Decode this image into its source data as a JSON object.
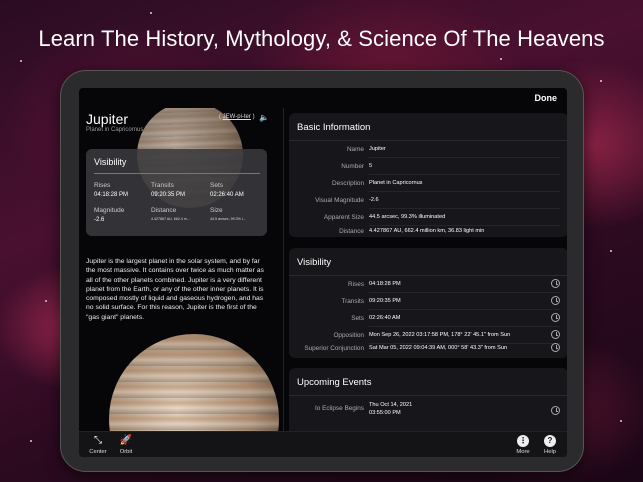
{
  "headline": "Learn The History, Mythology, & Science Of The Heavens",
  "topbar": {
    "done_label": "Done"
  },
  "object": {
    "name": "Jupiter",
    "subtitle": "Planet in Capricornus",
    "pronunciation_open": "(",
    "pronunciation": "JEW-pi-ter",
    "pronunciation_close": ")",
    "speaker_icon": "speaker-icon"
  },
  "visibility_card": {
    "title": "Visibility",
    "rises_label": "Rises",
    "rises_value": "04:18:28 PM",
    "transits_label": "Transits",
    "transits_value": "09:20:35 PM",
    "sets_label": "Sets",
    "sets_value": "02:26:40 AM",
    "magnitude_label": "Magnitude",
    "magnitude_value": "-2.6",
    "distance_label": "Distance",
    "distance_value": "4.427867 AU, 662.4 m...",
    "size_label": "Size",
    "size_value": "44.5 arcsec, 99.3% i..."
  },
  "description": "Jupiter is the largest planet in the solar system, and by far the most massive. It contains over twice as much matter as all of the other planets combined. Jupiter is a very different planet from the Earth, or any of the other inner planets. It is composed mostly of liquid and gaseous hydrogen, and has no solid surface. For this reason, Jupiter is the first of the \"gas giant\" planets.",
  "basic_info": {
    "title": "Basic Information",
    "rows": [
      {
        "label": "Name",
        "value": "Jupiter"
      },
      {
        "label": "Number",
        "value": "5"
      },
      {
        "label": "Description",
        "value": "Planet in Capricornus"
      },
      {
        "label": "Visual Magnitude",
        "value": "-2.6"
      },
      {
        "label": "Apparent Size",
        "value": "44.5 arcsec, 99.3% illuminated"
      },
      {
        "label": "Distance",
        "value": "4.427867 AU, 662.4 million km, 36.83 light min"
      }
    ]
  },
  "visibility": {
    "title": "Visibility",
    "rows": [
      {
        "label": "Rises",
        "value": "04:18:28 PM"
      },
      {
        "label": "Transits",
        "value": "09:20:35 PM"
      },
      {
        "label": "Sets",
        "value": "02:26:40 AM"
      },
      {
        "label": "Opposition",
        "value": "Mon Sep 26, 2022  03:17:58 PM, 178° 22' 45.1\" from Sun"
      },
      {
        "label": "Superior Conjunction",
        "value": "Sat Mar 05, 2022  09:04:39 AM, 000° 58' 43.3\" from Sun"
      }
    ]
  },
  "events": {
    "title": "Upcoming Events",
    "rows": [
      {
        "label": "Io Eclipse Begins",
        "value_line1": "Thu Oct 14, 2021",
        "value_line2": "03:55:00 PM"
      }
    ]
  },
  "toolbar": {
    "center_label": "Center",
    "orbit_label": "Orbit",
    "more_label": "More",
    "help_label": "Help"
  }
}
